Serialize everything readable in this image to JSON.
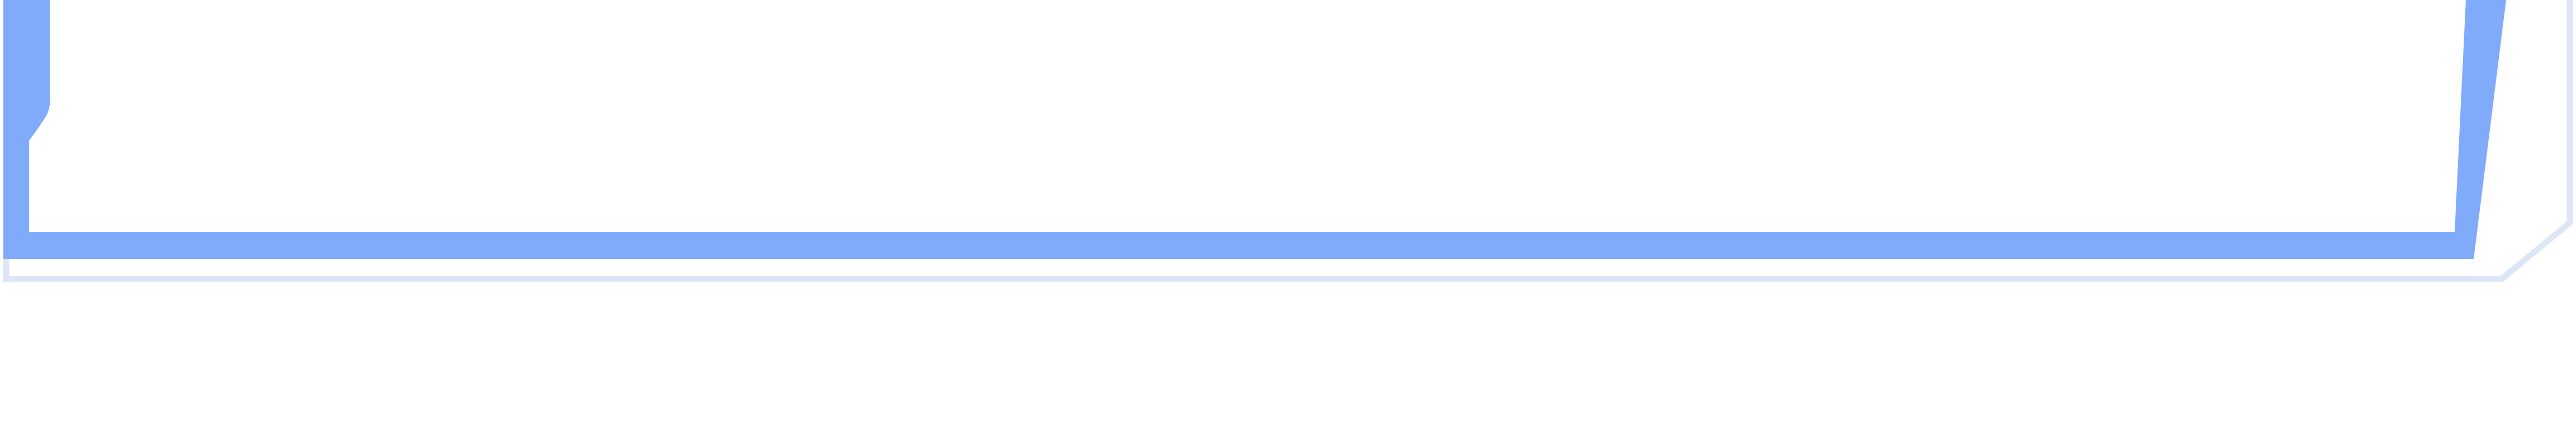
{
  "decoration": {
    "outer_frame": {
      "color": "#DDE6F7"
    },
    "inner_frame": {
      "color": "#7FABFA"
    }
  }
}
